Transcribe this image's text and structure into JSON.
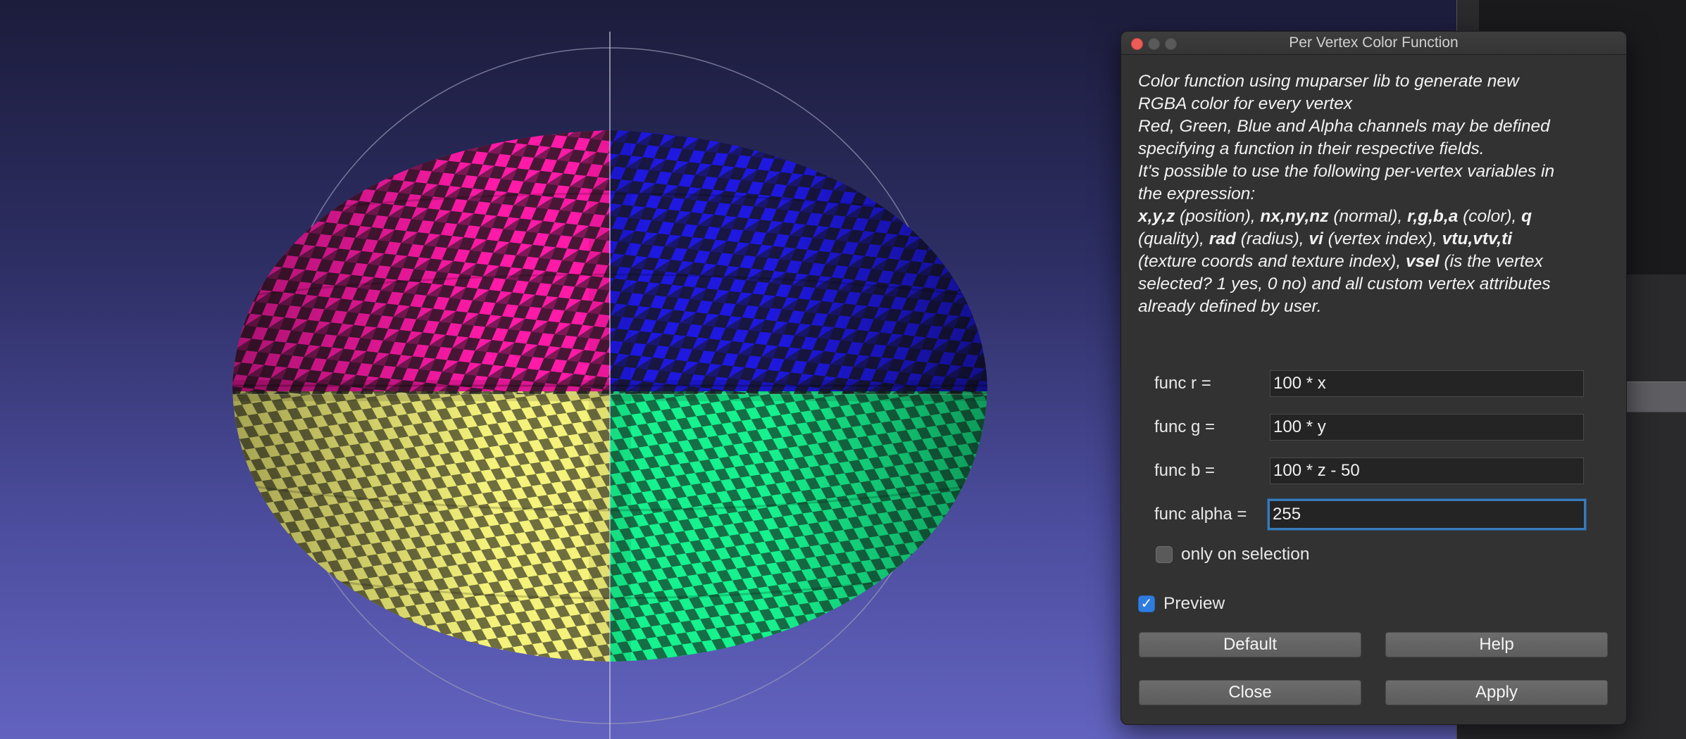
{
  "dialog": {
    "title": "Per Vertex Color Function",
    "description_lines": [
      [
        "Color function using muparser lib to generate new"
      ],
      [
        "RGBA color for every vertex"
      ],
      [
        "Red, Green, Blue and Alpha channels may be defined"
      ],
      [
        "specifying a function in their respective fields."
      ],
      [
        "It's possible to use the following per-vertex variables in"
      ],
      [
        "the expression:"
      ]
    ],
    "variables_text": {
      "v1": "x,y,z",
      "t1": " (position), ",
      "v2": "nx,ny,nz",
      "t2": " (normal), ",
      "v3": "r,g,b,a",
      "t3": " (color), ",
      "v4": "q",
      "t4": "(quality), ",
      "v5": "rad",
      "t5": " (radius), ",
      "v6": "vi",
      "t6": " (vertex index), ",
      "v7": "vtu,vtv,ti",
      "t7": "(texture coords and texture index), ",
      "v8": "vsel",
      "t8": " (is the vertex",
      "t9": "selected? 1 yes, 0 no) and all custom vertex attributes",
      "t10": "already defined by user."
    },
    "fields": {
      "r": {
        "label": "func r =",
        "value": "100 * x"
      },
      "g": {
        "label": "func g =",
        "value": "100 * y"
      },
      "b": {
        "label": "func b =",
        "value": "100 * z - 50"
      },
      "alpha": {
        "label": "func alpha =",
        "value": "255"
      }
    },
    "only_on_selection": {
      "label": "only on selection",
      "checked": false
    },
    "preview": {
      "label": "Preview",
      "checked": true
    },
    "buttons": {
      "default": "Default",
      "help": "Help",
      "close": "Close",
      "apply": "Apply"
    }
  },
  "colors": {
    "quadrant_top_left": "#ff1aa8",
    "quadrant_top_right": "#1e18e0",
    "quadrant_bottom_left": "#f4f27a",
    "quadrant_bottom_right": "#16f28e",
    "checker_dark": "#161616",
    "accent": "#2f7ce0"
  }
}
